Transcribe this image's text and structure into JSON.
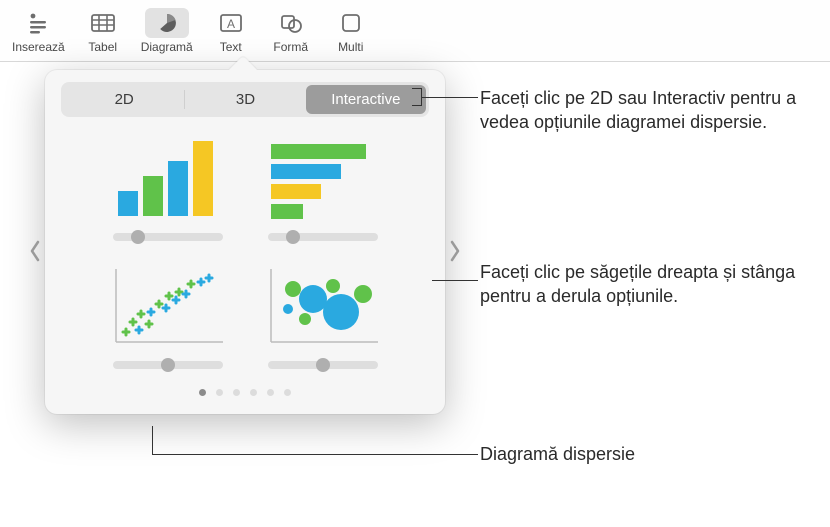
{
  "toolbar": {
    "items": [
      {
        "label": "Inserează"
      },
      {
        "label": "Tabel"
      },
      {
        "label": "Diagramă"
      },
      {
        "label": "Text"
      },
      {
        "label": "Formă"
      },
      {
        "label": "Multi"
      }
    ]
  },
  "popover": {
    "tabs": {
      "tab2d": "2D",
      "tab3d": "3D",
      "tabInteractive": "Interactive"
    },
    "charts": {
      "barChart": "interactive-bar-chart",
      "hbarChart": "interactive-horizontal-bar-chart",
      "scatterChart": "interactive-scatter-chart",
      "bubbleChart": "interactive-bubble-chart"
    },
    "colors": {
      "blue": "#2AA9E0",
      "green": "#60C24A",
      "yellow": "#F5C724",
      "track": "#dedede"
    },
    "pageCount": 6,
    "activePage": 0
  },
  "callouts": {
    "tabs": "Faceți clic pe 2D sau Interactiv pentru a vedea opțiunile diagramei dispersie.",
    "arrows": "Faceți clic pe săgețile dreapta și stânga pentru a derula opțiunile.",
    "scatter": "Diagramă dispersie"
  }
}
